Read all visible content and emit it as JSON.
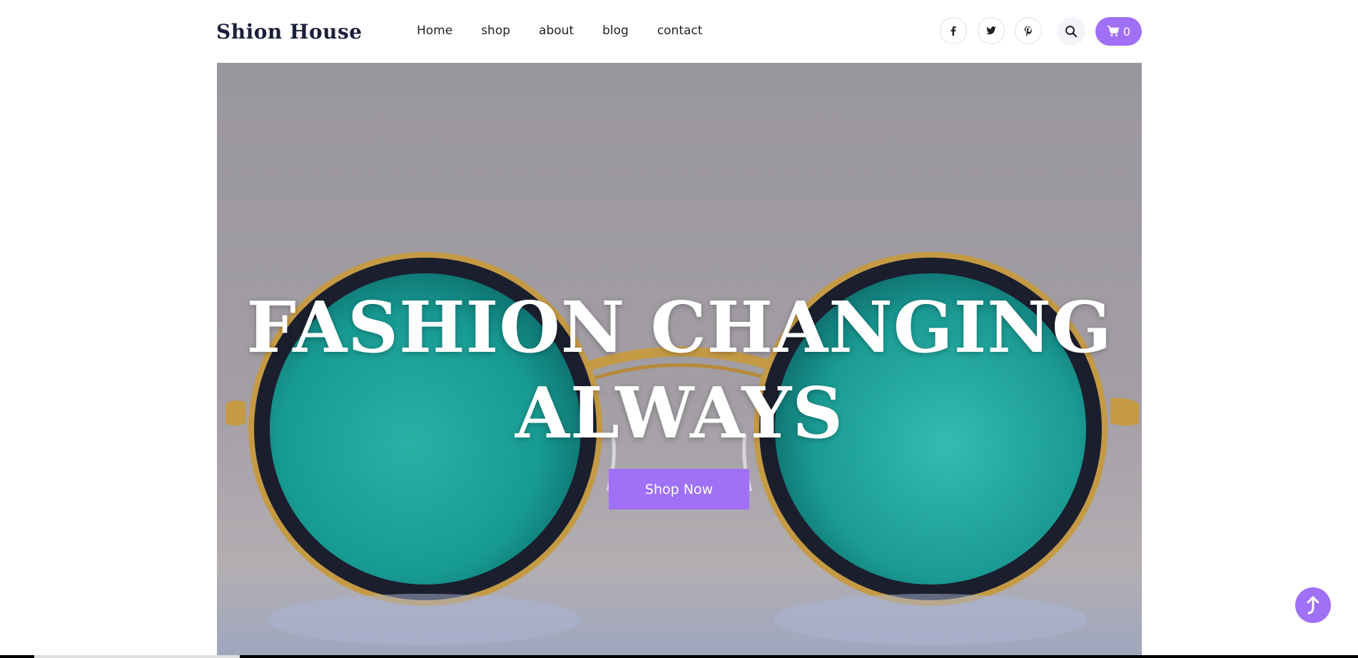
{
  "brand": {
    "logo": "Shion House"
  },
  "nav": {
    "items": [
      "Home",
      "shop",
      "about",
      "blog",
      "contact"
    ]
  },
  "social": [
    "facebook-icon",
    "twitter-icon",
    "pinterest-icon"
  ],
  "cart": {
    "count": "0"
  },
  "hero": {
    "title_line1": "FASHION CHANGING",
    "title_line2": "ALWAYS",
    "cta_label": "Shop Now"
  },
  "colors": {
    "accent": "#a070f6",
    "logo": "#1c1f3a",
    "lens": "#1f9f98",
    "frame": "#c59a45"
  }
}
